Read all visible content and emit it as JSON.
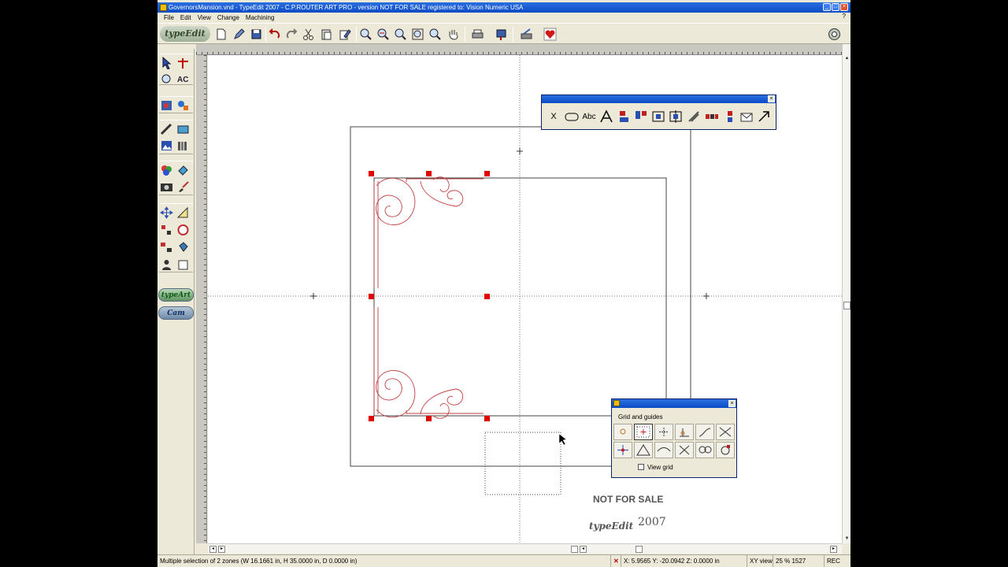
{
  "window": {
    "title": "GovernorsMansion.vnd - TypeEdit 2007 - C.P.ROUTER ART PRO - version NOT FOR SALE registered to: Vision Numeric USA"
  },
  "menu": [
    "File",
    "Edit",
    "View",
    "Change",
    "Machining"
  ],
  "menu_help": "?",
  "toolbar": {
    "logo": "typeEdit",
    "icons": [
      "new-file-icon",
      "pen-icon",
      "save-icon",
      "undo-icon",
      "redo-icon",
      "scissors-icon",
      "paste-icon",
      "edit-icon",
      "zoom-in-icon",
      "zoom-out-icon",
      "zoom-window-icon",
      "zoom-fit-icon",
      "zoom-page-icon",
      "pan-hand-icon",
      "print-icon",
      "send-icon",
      "machine-icon",
      "favorite-heart-icon",
      "help-globe-icon"
    ]
  },
  "toolbox": {
    "modules": [
      "typeArt",
      "Cam"
    ]
  },
  "text_toolbar": {
    "items": [
      "X",
      "Abc"
    ],
    "icons": [
      "close-x-icon",
      "rounded-rect-icon",
      "text-abc-icon",
      "outline-a-icon",
      "align-left-icon",
      "align-top-icon",
      "center-horizontal-icon",
      "center-vertical-icon",
      "diagonal-icon",
      "distribute-icon",
      "stack-icon",
      "envelope-icon",
      "arrow-icon"
    ]
  },
  "grid_panel": {
    "label": "Grid and guides",
    "view_grid": "View grid",
    "view_grid_checked": false
  },
  "status": {
    "message": "Multiple selection of 2 zones (W 16.1661 in, H 35.0000 in, D 0.0000 in)",
    "coords": "X: 5.9565  Y: -20.0942  Z: 0.0000 in",
    "view": "XY view",
    "zoom": "25 % 1527",
    "mode": "REC"
  },
  "watermark": {
    "text": "NOT FOR SALE",
    "brand": "typeEdit",
    "year": "2007"
  },
  "colors": {
    "selection_handle": "#e00000",
    "ornament_stroke": "#c04040",
    "titlebar": "#0b4bc6"
  }
}
